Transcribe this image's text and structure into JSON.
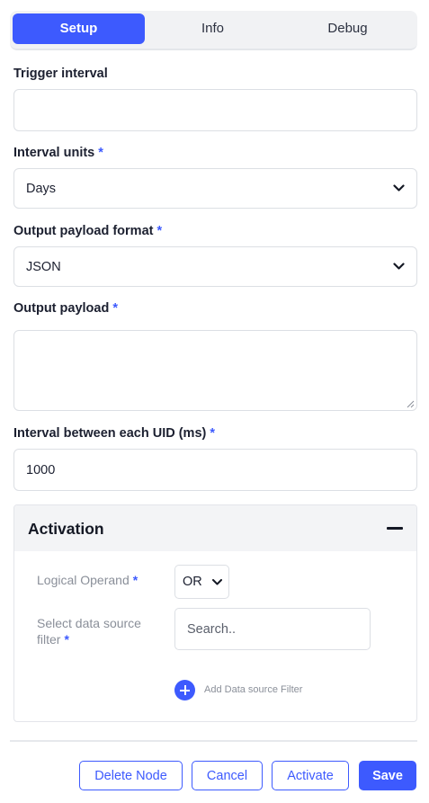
{
  "tabs": [
    {
      "label": "Setup",
      "active": true
    },
    {
      "label": "Info",
      "active": false
    },
    {
      "label": "Debug",
      "active": false
    }
  ],
  "form": {
    "trigger_interval": {
      "label": "Trigger interval",
      "value": ""
    },
    "interval_units": {
      "label": "Interval units",
      "required": "*",
      "value": "Days"
    },
    "output_format": {
      "label": "Output payload format",
      "required": "*",
      "value": "JSON"
    },
    "output_payload": {
      "label": "Output payload",
      "required": "*",
      "value": ""
    },
    "uid_interval": {
      "label": "Interval between each UID (ms)",
      "required": "*",
      "value": "1000"
    }
  },
  "activation": {
    "title": "Activation",
    "logical_operand": {
      "label": "Logical Operand",
      "required": "*",
      "value": "OR"
    },
    "data_source_filter": {
      "label_line1": "Select data source",
      "label_line2": "filter",
      "required": "*",
      "placeholder": "Search.."
    },
    "add_filter_label": "Add Data source Filter"
  },
  "footer": {
    "delete_label": "Delete Node",
    "cancel_label": "Cancel",
    "activate_label": "Activate",
    "save_label": "Save"
  },
  "icons": {
    "dropdown": "chevron-down-icon",
    "collapse": "minus-icon",
    "add": "plus-circle-icon"
  },
  "colors": {
    "accent": "#3d5afe",
    "text": "#1c2030",
    "muted": "#8a8f99",
    "border": "#dcdfe4"
  }
}
